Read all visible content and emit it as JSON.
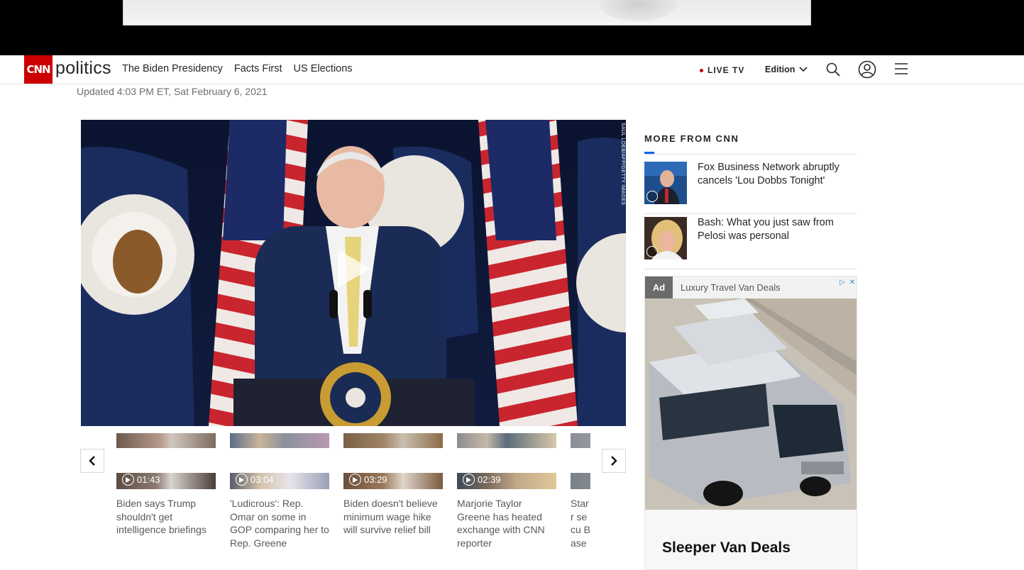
{
  "nav": {
    "logo": "CNN",
    "section": "politics",
    "links": [
      "The Biden Presidency",
      "Facts First",
      "US Elections"
    ],
    "live_tv": "LIVE TV",
    "edition": "Edition"
  },
  "article": {
    "updated": "Updated 4:03 PM ET, Sat February 6, 2021",
    "photo_credit": "SAUL LOEB/AFP/GETTY IMAGES"
  },
  "carousel": {
    "items": [
      {
        "duration": "01:43",
        "caption": "Biden says Trump shouldn't get intelligence briefings"
      },
      {
        "duration": "03:04",
        "caption": "'Ludicrous': Rep. Omar on some in GOP comparing her to Rep. Greene"
      },
      {
        "duration": "03:29",
        "caption": "Biden doesn't believe minimum wage hike will survive relief bill"
      },
      {
        "duration": "02:39",
        "caption": "Marjorie Taylor Greene has heated exchange with CNN reporter"
      },
      {
        "duration": "",
        "caption": "Starr secu Base"
      }
    ]
  },
  "sidebar": {
    "title": "MORE FROM CNN",
    "stories": [
      {
        "title": "Fox Business Network abruptly cancels 'Lou Dobbs Tonight'"
      },
      {
        "title": "Bash: What you just saw from Pelosi was personal"
      }
    ],
    "ad": {
      "tag": "Ad",
      "sponsor": "Luxury Travel Van Deals",
      "headline": "Sleeper Van Deals"
    }
  },
  "colors": {
    "brand_red": "#cc0000",
    "accent_blue": "#0c63e7"
  }
}
